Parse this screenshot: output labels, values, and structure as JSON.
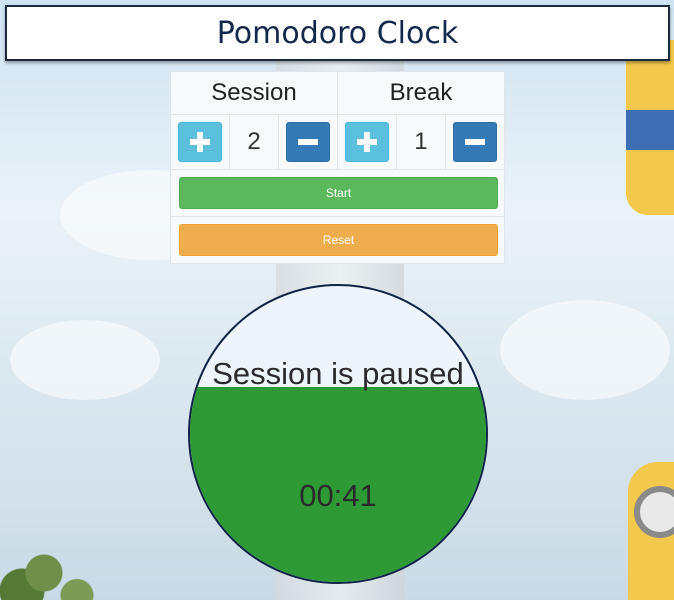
{
  "app": {
    "title": "Pomodoro Clock"
  },
  "controls": {
    "session": {
      "label": "Session",
      "value": "2"
    },
    "break": {
      "label": "Break",
      "value": "1"
    },
    "start_label": "Start",
    "reset_label": "Reset"
  },
  "clock": {
    "status": "Session is paused",
    "time": "00:41",
    "fill_fraction": 0.66
  },
  "colors": {
    "increment": "#5bc0de",
    "decrement": "#337ab7",
    "start": "#5cb85c",
    "reset": "#f0ad4e",
    "clock_fill": "#2e9a36"
  },
  "icons": {
    "increment": "plus-icon",
    "decrement": "minus-icon"
  }
}
